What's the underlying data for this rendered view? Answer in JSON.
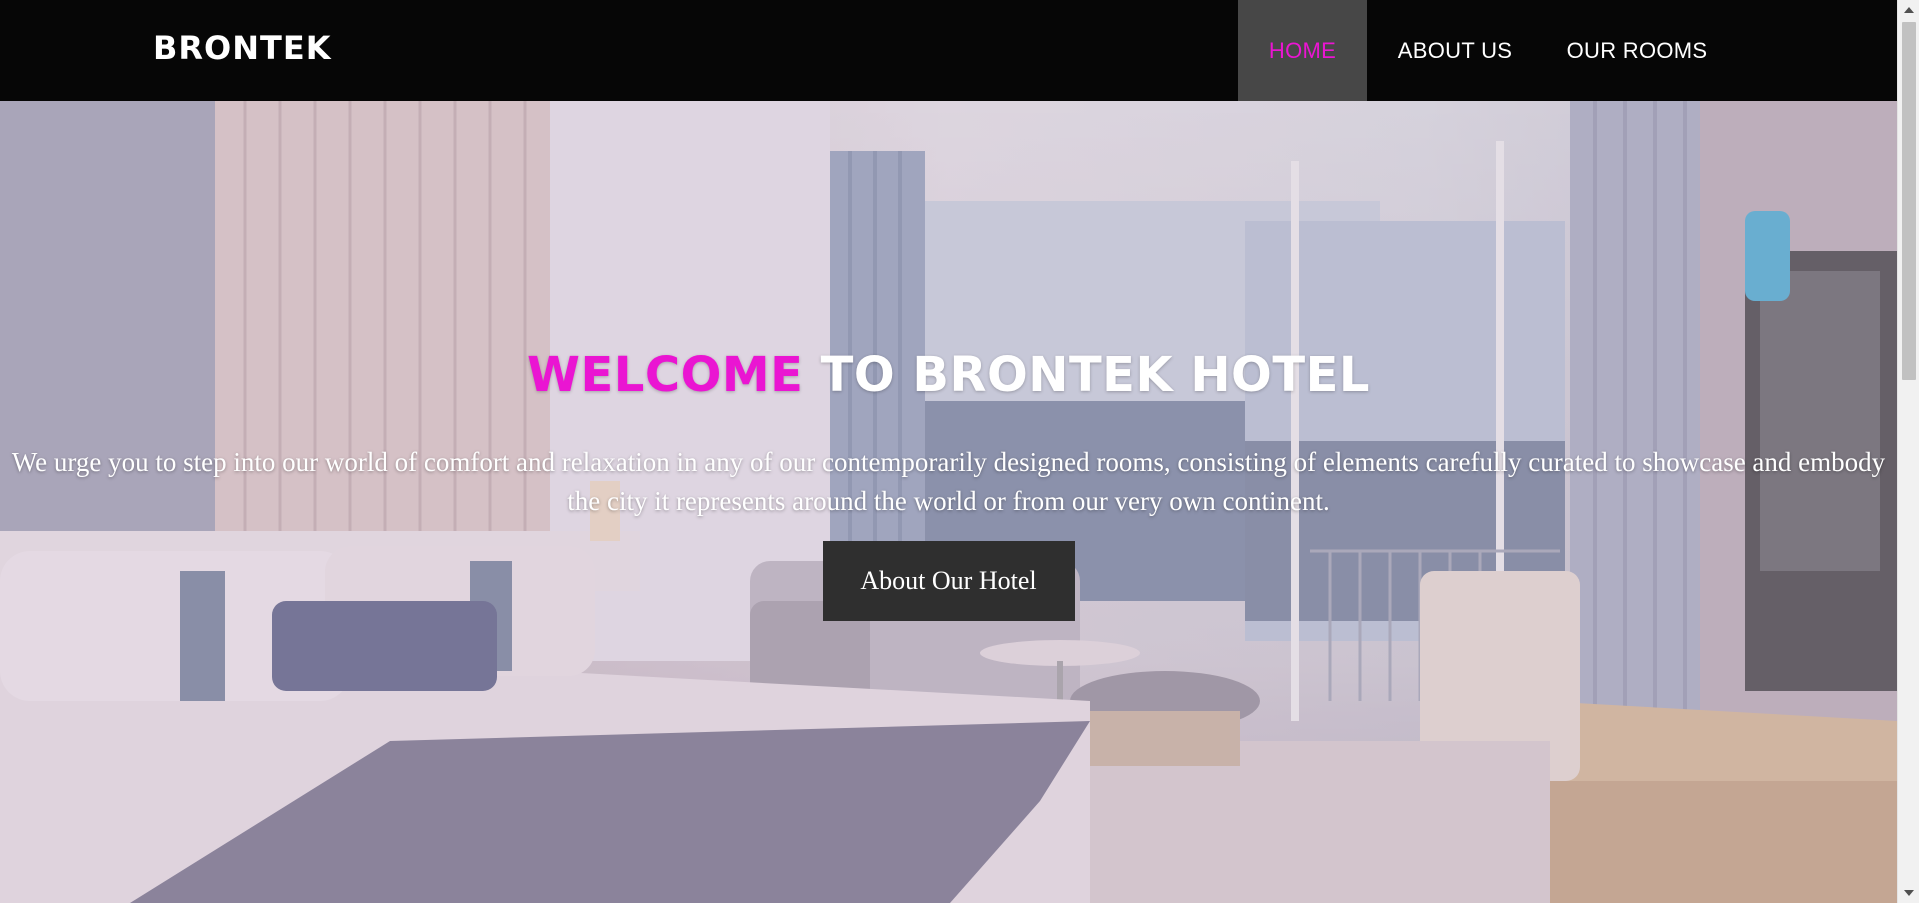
{
  "header": {
    "brand": "BRONTEK",
    "nav": [
      {
        "label": "HOME",
        "active": true
      },
      {
        "label": "ABOUT US",
        "active": false
      },
      {
        "label": "OUR ROOMS",
        "active": false
      }
    ]
  },
  "hero": {
    "title_accent": "WELCOME",
    "title_rest": "TO BRONTEK HOTEL",
    "tagline": "We urge you to step into our world of comfort and relaxation in any of our contemporarily designed rooms, consisting of elements carefully curated to showcase and embody the city it represents around the world or from our very own continent.",
    "cta_label": "About Our Hotel",
    "background_image": "hotel-room-photo"
  },
  "colors": {
    "accent": "#ea15d2",
    "nav_bg": "#060606",
    "nav_active_bg": "#474747",
    "button_bg": "#2f2f2f",
    "text": "#ffffff"
  }
}
